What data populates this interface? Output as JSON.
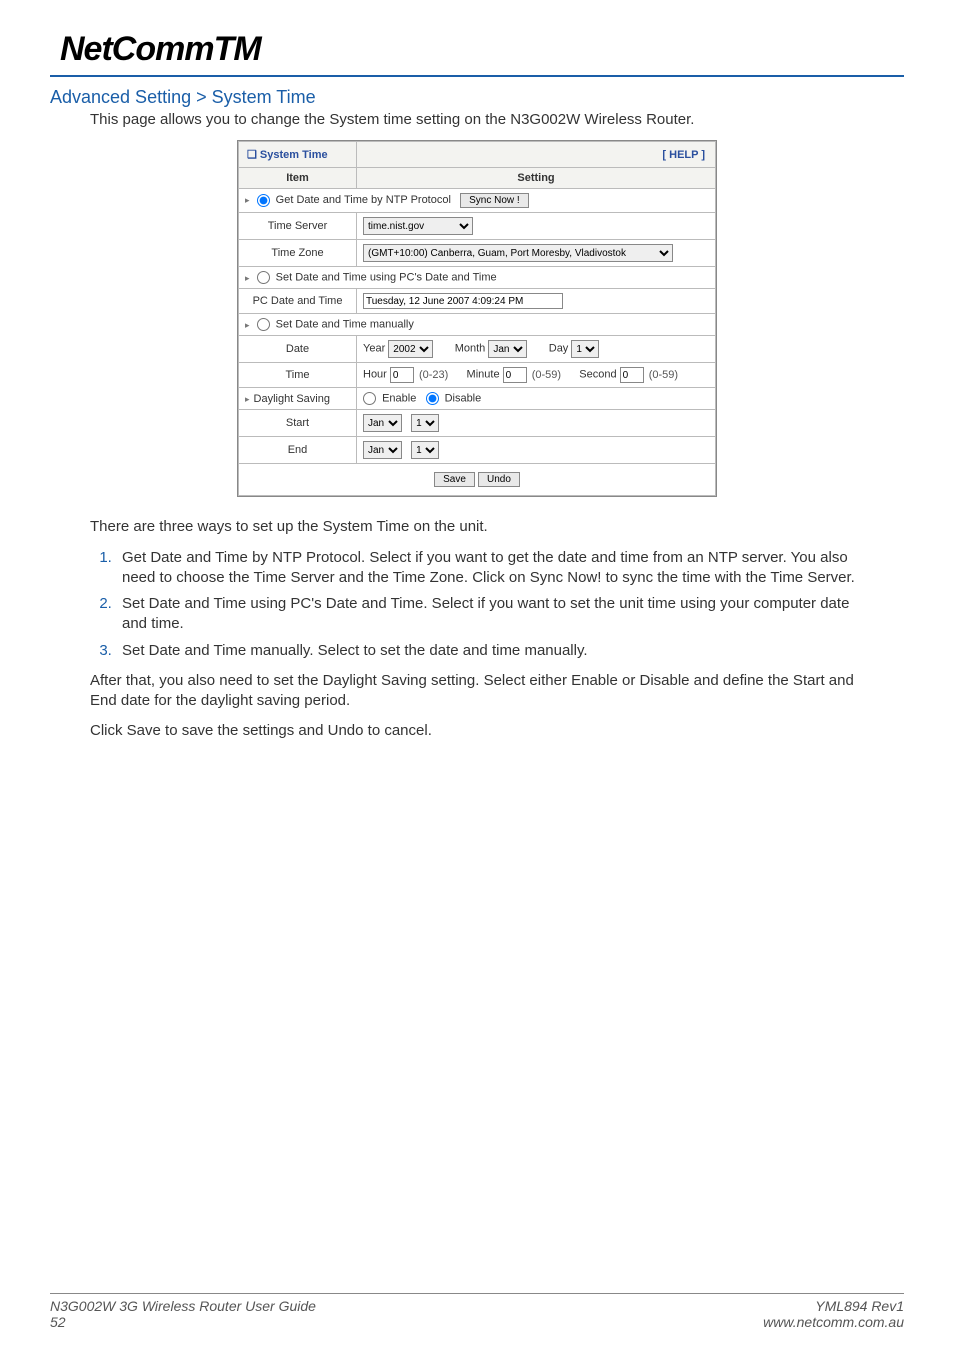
{
  "brand": {
    "name": "NetComm",
    "tm": "TM"
  },
  "title": "Advanced Setting > System Time",
  "intro": "This page allows you to change the System time setting on the N3G002W Wireless Router.",
  "shot": {
    "panel_title": "System Time",
    "help": "[ HELP ]",
    "col_item": "Item",
    "col_setting": "Setting",
    "ntp_label": "Get Date and Time by NTP Protocol",
    "sync_btn": "Sync Now !",
    "time_server_label": "Time Server",
    "time_server_value": "time.nist.gov",
    "time_zone_label": "Time Zone",
    "time_zone_value": "(GMT+10:00) Canberra, Guam, Port Moresby, Vladivostok",
    "pc_label": "Set Date and Time using PC's Date and Time",
    "pc_date_label": "PC Date and Time",
    "pc_date_value": "Tuesday, 12 June 2007 4:09:24 PM",
    "manual_label": "Set Date and Time manually",
    "date_label": "Date",
    "year_label": "Year",
    "year_value": "2002",
    "month_label": "Month",
    "month_value": "Jan",
    "day_label": "Day",
    "day_value": "1",
    "time_label": "Time",
    "hour_label": "Hour",
    "hour_value": "0",
    "hour_hint": "(0-23)",
    "minute_label": "Minute",
    "minute_value": "0",
    "minute_hint": "(0-59)",
    "second_label": "Second",
    "second_value": "0",
    "second_hint": "(0-59)",
    "daylight_label": "Daylight Saving",
    "enable_label": "Enable",
    "disable_label": "Disable",
    "start_label": "Start",
    "start_month": "Jan",
    "start_day": "1",
    "end_label": "End",
    "end_month": "Jan",
    "end_day": "1",
    "save_btn": "Save",
    "undo_btn": "Undo"
  },
  "body": {
    "lead": "There are three ways to set up the System Time on the unit.",
    "items": {
      "i1": "Get Date and Time by NTP Protocol. Select if you want to get the date and time from an NTP server. You also need to choose the Time Server and the Time Zone. Click on Sync Now! to sync the time with the Time Server.",
      "i2": "Set Date and Time using PC's Date and Time.  Select if you want to set the unit time using your computer date and time.",
      "i3": "Set Date and Time manually. Select to set the date and time manually."
    },
    "after1": "After that, you also need to set the Daylight Saving setting. Select either Enable or Disable and define the Start and End date for the daylight saving period.",
    "after2": "Click Save to save the settings and Undo to cancel."
  },
  "footer": {
    "left1": "N3G002W 3G Wireless Router User Guide",
    "left2": "52",
    "right1": "YML894 Rev1",
    "right2": "www.netcomm.com.au"
  }
}
